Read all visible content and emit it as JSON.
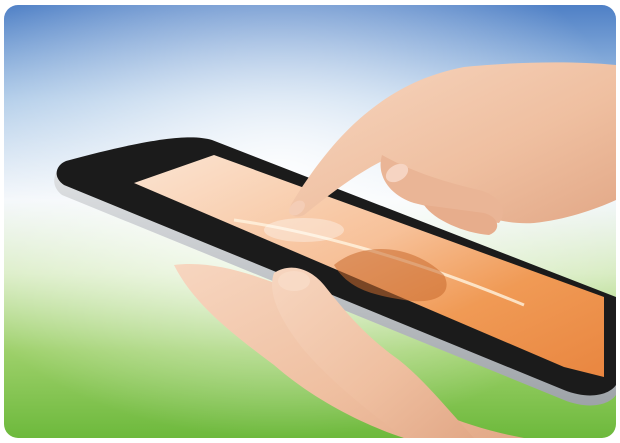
{
  "image": {
    "subject": "hand-touching-tablet",
    "palette": {
      "sky_blue": "#5f8fcf",
      "light_blue": "#cfe2f2",
      "grass_green": "#7cc24a",
      "light_green": "#cfe8b8",
      "screen_glow": "#f4a868",
      "skin": "#f2c6a8",
      "tablet_frame": "#1b1b1b",
      "tablet_edge": "#b8bcc0"
    }
  }
}
